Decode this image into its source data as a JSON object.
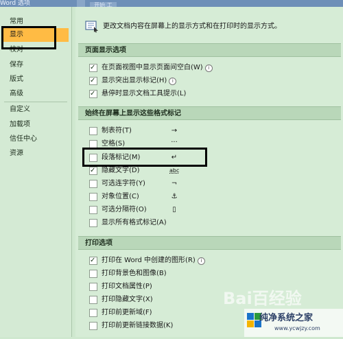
{
  "window": {
    "title": "Word 选项",
    "tab_fragments": [
      "",
      "开始 工"
    ]
  },
  "sidebar": {
    "items": [
      {
        "label": "常用",
        "active": false
      },
      {
        "label": "显示",
        "active": true
      },
      {
        "label": "校对",
        "active": false
      },
      {
        "label": "保存",
        "active": false
      },
      {
        "label": "版式",
        "active": false
      },
      {
        "label": "高级",
        "active": false
      },
      {
        "label": "自定义",
        "active": false
      },
      {
        "label": "加载项",
        "active": false
      },
      {
        "label": "信任中心",
        "active": false
      },
      {
        "label": "资源",
        "active": false
      }
    ]
  },
  "main": {
    "description": "更改文档内容在屏幕上的显示方式和在打印时的显示方式。",
    "description_icon": "monitor-icon",
    "sections": [
      {
        "header": "页面显示选项",
        "options": [
          {
            "label": "在页面视图中显示页面间空白(W)",
            "checked": true,
            "info": true
          },
          {
            "label": "显示突出显示标记(H)",
            "checked": true,
            "info": true
          },
          {
            "label": "悬停时显示文档工具提示(L)",
            "checked": true,
            "info": false
          }
        ]
      },
      {
        "header": "始终在屏幕上显示这些格式标记",
        "options": [
          {
            "label": "制表符(T)",
            "checked": false,
            "mark": "→"
          },
          {
            "label": "空格(S)",
            "checked": false,
            "mark": "···"
          },
          {
            "label": "段落标记(M)",
            "checked": false,
            "mark": "↵"
          },
          {
            "label": "隐藏文字(D)",
            "checked": true,
            "mark": "abc"
          },
          {
            "label": "可选连字符(Y)",
            "checked": false,
            "mark": "¬"
          },
          {
            "label": "对象位置(C)",
            "checked": false,
            "mark": "⚓"
          },
          {
            "label": "可选分隔符(O)",
            "checked": false,
            "mark": "▯"
          },
          {
            "label": "显示所有格式标记(A)",
            "checked": false,
            "mark": ""
          }
        ]
      },
      {
        "header": "打印选项",
        "options": [
          {
            "label": "打印在 Word 中创建的图形(R)",
            "checked": true,
            "info": true
          },
          {
            "label": "打印背景色和图像(B)",
            "checked": false
          },
          {
            "label": "打印文档属性(P)",
            "checked": false
          },
          {
            "label": "打印隐藏文字(X)",
            "checked": false
          },
          {
            "label": "打印前更新域(F)",
            "checked": false
          },
          {
            "label": "打印前更新链接数据(K)",
            "checked": false
          }
        ]
      }
    ]
  },
  "watermarks": {
    "baidu": "Bai百经验",
    "site_name": "纯净系统之家",
    "site_url": "www.ycwjzy.com"
  },
  "colors": {
    "background": "#cfe8cf",
    "active_nav": "#ffbb44",
    "section_header": "#b9d7b9",
    "title_bar": "#6e8fb8"
  }
}
